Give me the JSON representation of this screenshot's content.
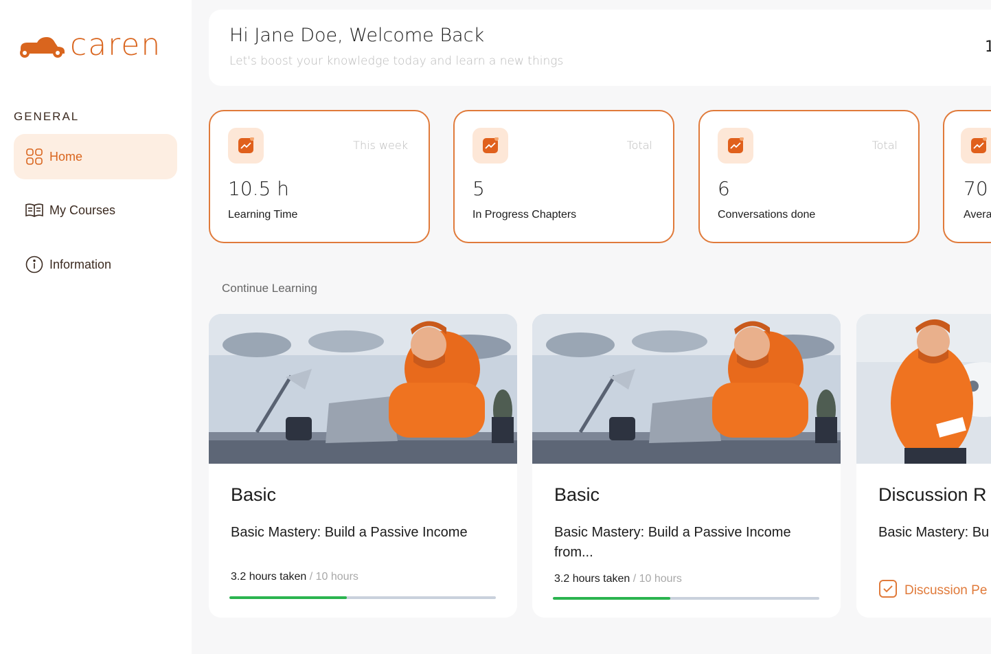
{
  "brand": {
    "name": "caren",
    "accent": "#d9651e"
  },
  "sidebar": {
    "section_label": "GENERAL",
    "items": [
      {
        "label": "Home",
        "icon": "grid-icon",
        "active": true
      },
      {
        "label": "My Courses",
        "icon": "book-icon",
        "active": false
      },
      {
        "label": "Information",
        "icon": "info-icon",
        "active": false
      }
    ]
  },
  "header": {
    "greeting": "Hi Jane Doe, Welcome Back",
    "subtitle": "Let's boost your knowledge today and learn a new things",
    "right_number": "1"
  },
  "stats": [
    {
      "period": "This week",
      "value": "10.5 h",
      "label": "Learning Time"
    },
    {
      "period": "Total",
      "value": "5",
      "label": "In Progress Chapters"
    },
    {
      "period": "Total",
      "value": "6",
      "label": "Conversations done"
    },
    {
      "period": "",
      "value": "70",
      "label": "Avera"
    }
  ],
  "continue_learning": {
    "title": "Continue Learning",
    "courses": [
      {
        "category": "Basic",
        "title": "Basic Mastery: Build a Passive Income",
        "hours_taken": "3.2 hours taken",
        "hours_total": " / 10 hours",
        "progress": 0.44
      },
      {
        "category": "Basic",
        "title": "Basic Mastery: Build a Passive Income from...",
        "hours_taken": "3.2 hours taken",
        "hours_total": " / 10 hours",
        "progress": 0.44
      },
      {
        "category": "Discussion R",
        "title": "Basic Mastery: Bu from...",
        "discussion_label": "Discussion Pe"
      }
    ]
  },
  "colors": {
    "accent": "#e07a3a",
    "progress_fill": "#2bb44f",
    "progress_track": "#c9d1dc",
    "active_bg": "#fdeee2"
  }
}
